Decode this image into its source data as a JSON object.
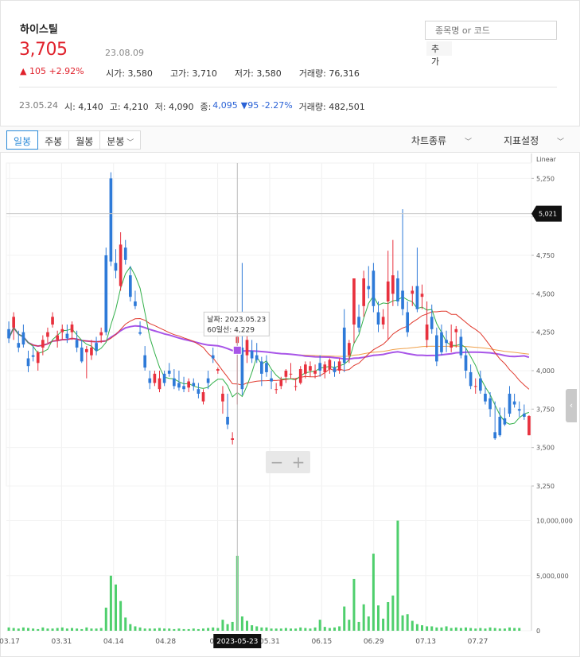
{
  "stock": {
    "name": "하이스틸",
    "price": "3,705",
    "date": "23.08.09",
    "change": "▲ 105 +2.92%",
    "stats": [
      "시가: 3,580",
      "고가: 3,710",
      "저가: 3,580",
      "거래량: 76,316"
    ]
  },
  "search": {
    "placeholder": "종목명 or 코드",
    "add_label": "추가"
  },
  "history": {
    "date": "23.05.24",
    "open": "시: 4,140",
    "high": "고: 4,210",
    "low": "저: 4,090",
    "close_label": "종:",
    "close_value": "4,095",
    "change": "▼95 -2.27%",
    "volume": "거래량: 482,501"
  },
  "toolbar": {
    "tabs": [
      "일봉",
      "주봉",
      "월봉",
      "분봉"
    ],
    "active_tab": "일봉",
    "chart_type": "차트종류",
    "indicator": "지표설정"
  },
  "colors": {
    "up": "#e8313e",
    "down": "#2e7ad8",
    "ma5": "#32b04a",
    "ma20": "#e03a2e",
    "ma60": "#a855e8",
    "ma120": "#f0a04a",
    "volume": "#4fcf6d"
  },
  "chart_data": {
    "type": "candlestick",
    "scale": "Linear",
    "price_ticks": [
      "5,250",
      "5,000",
      "4,750",
      "4,500",
      "4,250",
      "4,000",
      "3,750",
      "3,500",
      "3,250"
    ],
    "price_range": [
      3250,
      5350
    ],
    "volume_ticks": [
      "10,000,000",
      "5,000,000",
      "0"
    ],
    "volume_range": [
      0,
      13000000
    ],
    "x_ticks": [
      "03.17",
      "03.31",
      "04.14",
      "04.28",
      "05.1",
      "05.31",
      "06.15",
      "06.29",
      "07.13",
      "07.27"
    ],
    "crosshair": {
      "date": "2023-05-23",
      "price": "5,021",
      "tooltip_date": "날짜: 2023.05.23",
      "tooltip_ma": "60일선: 4,229"
    },
    "zoom": {
      "minus": "−",
      "plus": "+"
    },
    "candles": [
      [
        4270,
        4320,
        4180,
        4210
      ],
      [
        4280,
        4380,
        4200,
        4350
      ],
      [
        4180,
        4260,
        4120,
        4150
      ],
      [
        4250,
        4300,
        4150,
        4170
      ],
      [
        4080,
        4130,
        3990,
        4030
      ],
      [
        4100,
        4160,
        4060,
        4090
      ],
      [
        4050,
        4130,
        4000,
        4120
      ],
      [
        4150,
        4230,
        4100,
        4200
      ],
      [
        4220,
        4280,
        4180,
        4250
      ],
      [
        4300,
        4380,
        4280,
        4350
      ],
      [
        4200,
        4260,
        4150,
        4230
      ],
      [
        4250,
        4300,
        4200,
        4270
      ],
      [
        4240,
        4300,
        4180,
        4210
      ],
      [
        4250,
        4320,
        4200,
        4300
      ],
      [
        4200,
        4260,
        4120,
        4150
      ],
      [
        4150,
        4200,
        4050,
        4060
      ],
      [
        4120,
        4160,
        3950,
        4140
      ],
      [
        4100,
        4200,
        4070,
        4150
      ],
      [
        4180,
        4220,
        4100,
        4130
      ],
      [
        4230,
        4280,
        4180,
        4250
      ],
      [
        4750,
        4800,
        4230,
        4250
      ],
      [
        5250,
        5290,
        4680,
        4710
      ],
      [
        4700,
        4790,
        4600,
        4650
      ],
      [
        4550,
        4900,
        4520,
        4820
      ],
      [
        4800,
        4850,
        4690,
        4720
      ],
      [
        4620,
        4680,
        4450,
        4480
      ],
      [
        4450,
        4520,
        4400,
        4420
      ],
      [
        4250,
        4320,
        4230,
        4240
      ],
      [
        4100,
        4160,
        4000,
        4020
      ],
      [
        3950,
        4000,
        3880,
        3920
      ],
      [
        3920,
        4000,
        3900,
        3980
      ],
      [
        3880,
        4000,
        3860,
        3950
      ],
      [
        3980,
        4000,
        3900,
        3920
      ],
      [
        4000,
        4050,
        3960,
        3980
      ],
      [
        3950,
        4010,
        3880,
        3900
      ],
      [
        3920,
        4000,
        3870,
        3890
      ],
      [
        3900,
        3960,
        3860,
        3880
      ],
      [
        3890,
        3950,
        3860,
        3930
      ],
      [
        3920,
        3950,
        3870,
        3900
      ],
      [
        3880,
        3920,
        3820,
        3850
      ],
      [
        3800,
        3880,
        3780,
        3860
      ],
      [
        3950,
        4000,
        3880,
        3920
      ],
      [
        4100,
        4150,
        4050,
        4080
      ],
      [
        4000,
        4020,
        3980,
        4010
      ],
      [
        3800,
        3900,
        3720,
        3850
      ],
      [
        3700,
        3850,
        3620,
        3650
      ],
      [
        3550,
        3600,
        3520,
        3560
      ],
      [
        4180,
        4280,
        3780,
        4220
      ],
      [
        4150,
        4700,
        3840,
        3880
      ],
      [
        4100,
        4230,
        4050,
        4200
      ],
      [
        4130,
        4200,
        4050,
        4080
      ],
      [
        4100,
        4180,
        4050,
        4070
      ],
      [
        4060,
        4090,
        3900,
        3980
      ],
      [
        4050,
        4100,
        3960,
        3990
      ],
      [
        3950,
        4000,
        3880,
        3930
      ],
      [
        3880,
        3920,
        3850,
        3880
      ],
      [
        3900,
        3960,
        3880,
        3940
      ],
      [
        3960,
        4010,
        3920,
        4000
      ],
      [
        3980,
        4050,
        3950,
        3980
      ],
      [
        3900,
        3950,
        3870,
        3900
      ],
      [
        3920,
        4030,
        3910,
        4010
      ],
      [
        3980,
        4060,
        3950,
        4040
      ],
      [
        4000,
        4060,
        3960,
        4030
      ],
      [
        3980,
        4040,
        3950,
        4000
      ],
      [
        4050,
        4100,
        3960,
        4000
      ],
      [
        3990,
        4060,
        3950,
        4040
      ],
      [
        4010,
        4080,
        3980,
        4070
      ],
      [
        4020,
        4060,
        3960,
        3990
      ],
      [
        4000,
        4080,
        3980,
        4060
      ],
      [
        4280,
        4400,
        3990,
        4050
      ],
      [
        4100,
        4200,
        4050,
        4180
      ],
      [
        4300,
        4600,
        4180,
        4600
      ],
      [
        4350,
        4430,
        4250,
        4280
      ],
      [
        4420,
        4650,
        4350,
        4600
      ],
      [
        4550,
        4680,
        4470,
        4530
      ],
      [
        4650,
        4700,
        4380,
        4420
      ],
      [
        4380,
        4450,
        4250,
        4300
      ],
      [
        4300,
        4400,
        4270,
        4350
      ],
      [
        4450,
        4780,
        4200,
        4580
      ],
      [
        4500,
        4850,
        4420,
        4620
      ],
      [
        4600,
        4650,
        4420,
        4450
      ],
      [
        4520,
        5050,
        4360,
        4400
      ],
      [
        4380,
        4450,
        4220,
        4250
      ],
      [
        4500,
        4550,
        4420,
        4520
      ],
      [
        4550,
        4800,
        4380,
        4400
      ],
      [
        4480,
        4560,
        4400,
        4500
      ],
      [
        4200,
        4450,
        4150,
        4300
      ],
      [
        4350,
        4430,
        4240,
        4270
      ],
      [
        4230,
        4280,
        4030,
        4060
      ],
      [
        4250,
        4300,
        4100,
        4120
      ],
      [
        4200,
        4260,
        4120,
        4180
      ],
      [
        4150,
        4300,
        4120,
        4190
      ],
      [
        4250,
        4290,
        4150,
        4270
      ],
      [
        4220,
        4270,
        4080,
        4100
      ],
      [
        4100,
        4150,
        3950,
        4000
      ],
      [
        3990,
        4040,
        3880,
        3900
      ],
      [
        3900,
        3950,
        3850,
        3900
      ],
      [
        3950,
        4000,
        3850,
        3870
      ],
      [
        3850,
        3900,
        3780,
        3800
      ],
      [
        3820,
        3860,
        3700,
        3750
      ],
      [
        3600,
        3800,
        3550,
        3560
      ],
      [
        3700,
        3760,
        3570,
        3580
      ],
      [
        3690,
        3760,
        3640,
        3650
      ],
      [
        3850,
        3900,
        3700,
        3720
      ],
      [
        3800,
        3850,
        3760,
        3780
      ],
      [
        3750,
        3800,
        3700,
        3740
      ],
      [
        3720,
        3780,
        3680,
        3700
      ],
      [
        3580,
        3710,
        3580,
        3705
      ]
    ],
    "volume": [
      300000,
      250000,
      200000,
      300000,
      250000,
      200000,
      150000,
      300000,
      200000,
      200000,
      250000,
      300000,
      200000,
      250000,
      200000,
      150000,
      300000,
      200000,
      200000,
      250000,
      2100000,
      5000000,
      4200000,
      2700000,
      1200000,
      600000,
      400000,
      300000,
      200000,
      200000,
      200000,
      250000,
      200000,
      200000,
      150000,
      200000,
      150000,
      150000,
      200000,
      150000,
      200000,
      250000,
      300000,
      250000,
      1000000,
      600000,
      800000,
      6800000,
      1300000,
      900000,
      500000,
      400000,
      300000,
      300000,
      200000,
      200000,
      200000,
      250000,
      200000,
      200000,
      300000,
      250000,
      200000,
      300000,
      1000000,
      350000,
      250000,
      300000,
      400000,
      2200000,
      1000000,
      4700000,
      800000,
      2400000,
      1300000,
      7000000,
      2300000,
      1100000,
      2600000,
      3200000,
      10000000,
      1400000,
      1500000,
      900000,
      600000,
      500000,
      400000,
      400000,
      300000,
      300000,
      400000,
      250000,
      300000,
      250000,
      300000,
      250000,
      200000,
      250000,
      200000,
      300000,
      250000,
      200000,
      200000,
      300000,
      250000,
      250000
    ]
  }
}
